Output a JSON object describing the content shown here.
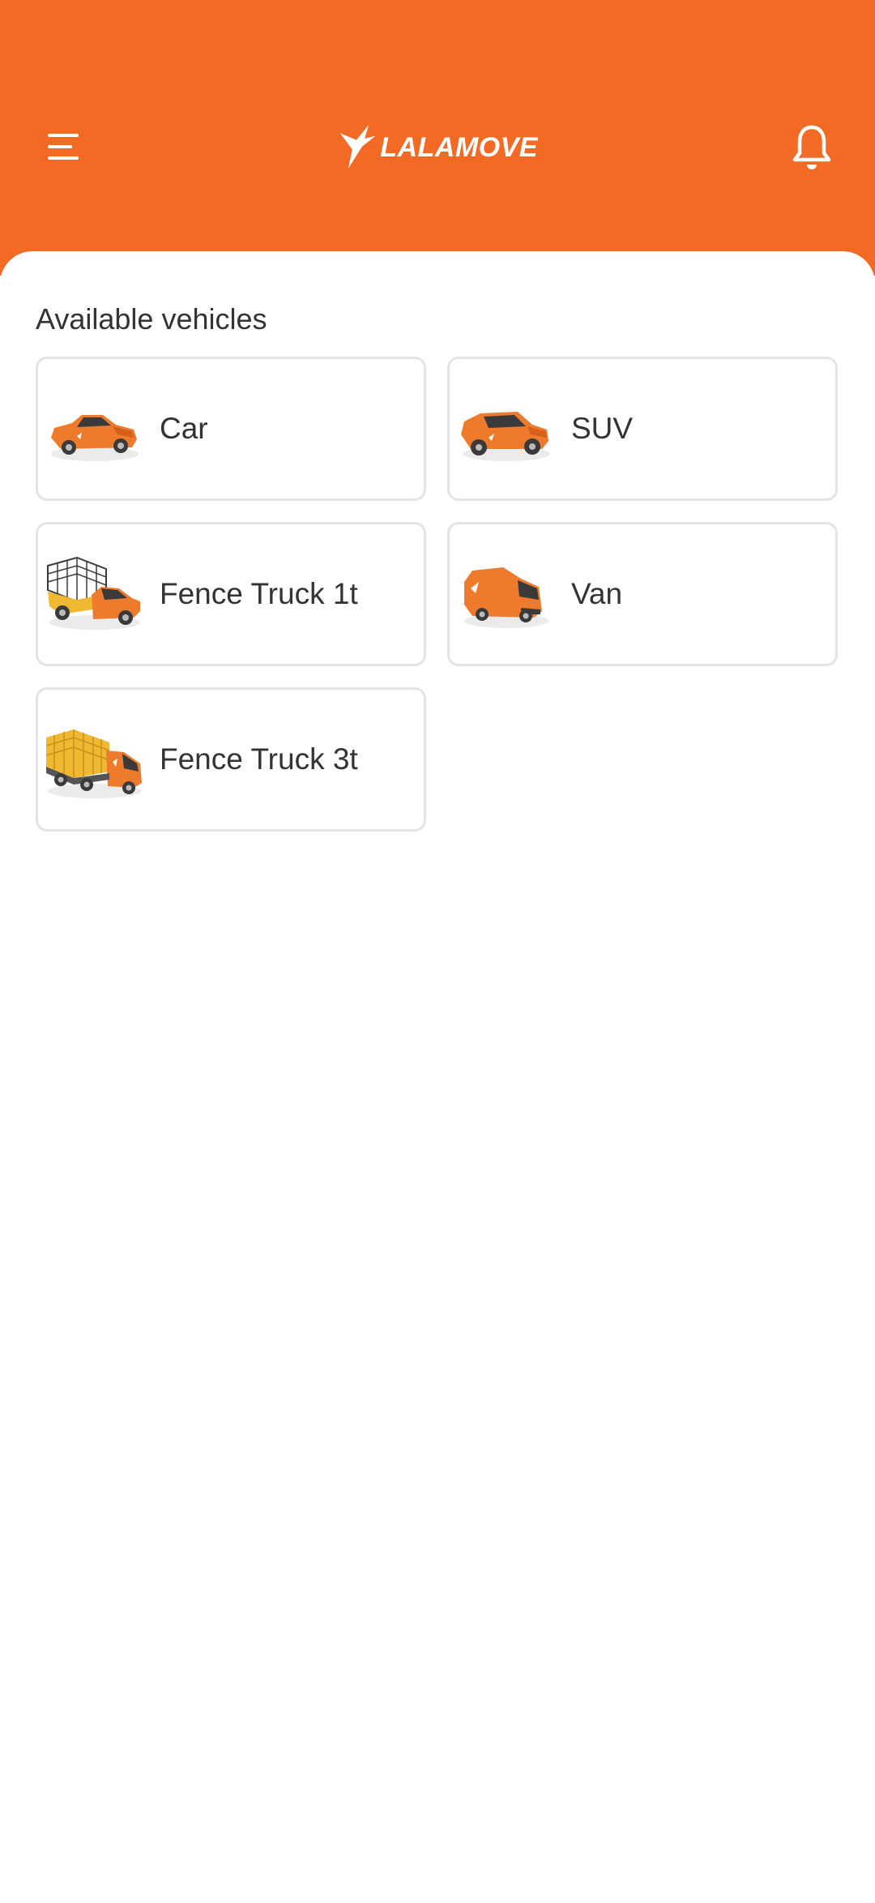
{
  "header": {
    "logo_text": "LALAMOVE",
    "background_color": "#f26a24",
    "menu_icon": "hamburger-menu-icon",
    "notification_icon": "bell-icon"
  },
  "main": {
    "section_title": "Available vehicles",
    "vehicles": [
      {
        "label": "Car",
        "icon": "car-image"
      },
      {
        "label": "SUV",
        "icon": "suv-image"
      },
      {
        "label": "Fence Truck 1t",
        "icon": "fence-truck-1t-image"
      },
      {
        "label": "Van",
        "icon": "van-image"
      },
      {
        "label": "Fence Truck 3t",
        "icon": "fence-truck-3t-image"
      }
    ]
  },
  "colors": {
    "brand_orange": "#f26a24",
    "vehicle_orange": "#ee7a2c",
    "fence_yellow": "#f0b830",
    "card_border": "#e4e4e4",
    "text_dark": "#333333"
  }
}
